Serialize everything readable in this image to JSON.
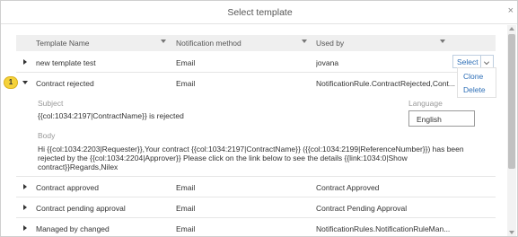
{
  "dialog": {
    "title": "Select template",
    "close_label": "×"
  },
  "table": {
    "columns": [
      "Template Name",
      "Notification method",
      "Used by"
    ],
    "rows": [
      {
        "name": "new template test",
        "method": "Email",
        "used_by": "jovana"
      },
      {
        "name": "Contract rejected",
        "method": "Email",
        "used_by": "NotificationRule.ContractRejected,Cont..."
      },
      {
        "name": "Contract approved",
        "method": "Email",
        "used_by": "Contract Approved"
      },
      {
        "name": "Contract pending approval",
        "method": "Email",
        "used_by": "Contract Pending Approval"
      },
      {
        "name": "Managed by changed",
        "method": "Email",
        "used_by": "NotificationRules.NotificationRuleMan..."
      }
    ]
  },
  "select_button": {
    "label": "Select"
  },
  "dropdown_menu": {
    "items": [
      "Clone",
      "Delete"
    ]
  },
  "badge": {
    "number": "1"
  },
  "detail": {
    "subject_label": "Subject",
    "subject_value": "{{col:1034:2197|ContractName}} is rejected",
    "language_label": "Language",
    "language_value": "English",
    "body_label": "Body",
    "body_value": "Hi {{col:1034:2203|Requester}},Your contract {{col:1034:2197|ContractName}} ({{col:1034:2199|ReferenceNumber}}) has been rejected by the {{col:1034:2204|Approver}} Please click on the link below to see the details {{link:1034:0|Show contract}}Regards,Nilex"
  },
  "colors": {
    "accent": "#2e6fb7",
    "badge": "#f5d23a",
    "header_bg": "#efefef"
  }
}
